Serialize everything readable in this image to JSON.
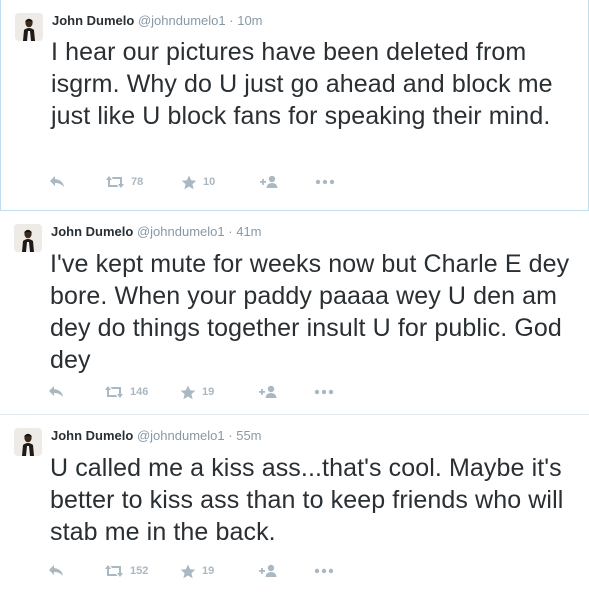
{
  "tweets": [
    {
      "name": "John Dumelo",
      "handle": "@johndumelo1",
      "dot": "·",
      "time": "10m",
      "text": "I hear our pictures have been deleted from isgrm. Why do U just go ahead and block me just like U block fans for speaking their mind.",
      "retweets": "78",
      "favorites": "10"
    },
    {
      "name": "John Dumelo",
      "handle": "@johndumelo1",
      "dot": "·",
      "time": "41m",
      "text": "I've kept mute for weeks now but Charle E dey bore. When your paddy paaaa wey U den am dey do things together insult U for public. God dey",
      "retweets": "146",
      "favorites": "19"
    },
    {
      "name": "John Dumelo",
      "handle": "@johndumelo1",
      "dot": "·",
      "time": "55m",
      "text": "U called me a kiss ass...that's cool. Maybe it's better to kiss ass than to keep friends who will stab me in the back.",
      "retweets": "152",
      "favorites": "19"
    }
  ],
  "icons": {
    "reply": "reply-icon",
    "retweet": "retweet-icon",
    "favorite": "star-icon",
    "follow": "follow-icon",
    "more": "more-icon"
  },
  "colors": {
    "text": "#292f33",
    "muted": "#8899a6",
    "action": "#aab8c2",
    "divider": "#e1e8ed",
    "highlight_border": "#c0deed"
  }
}
